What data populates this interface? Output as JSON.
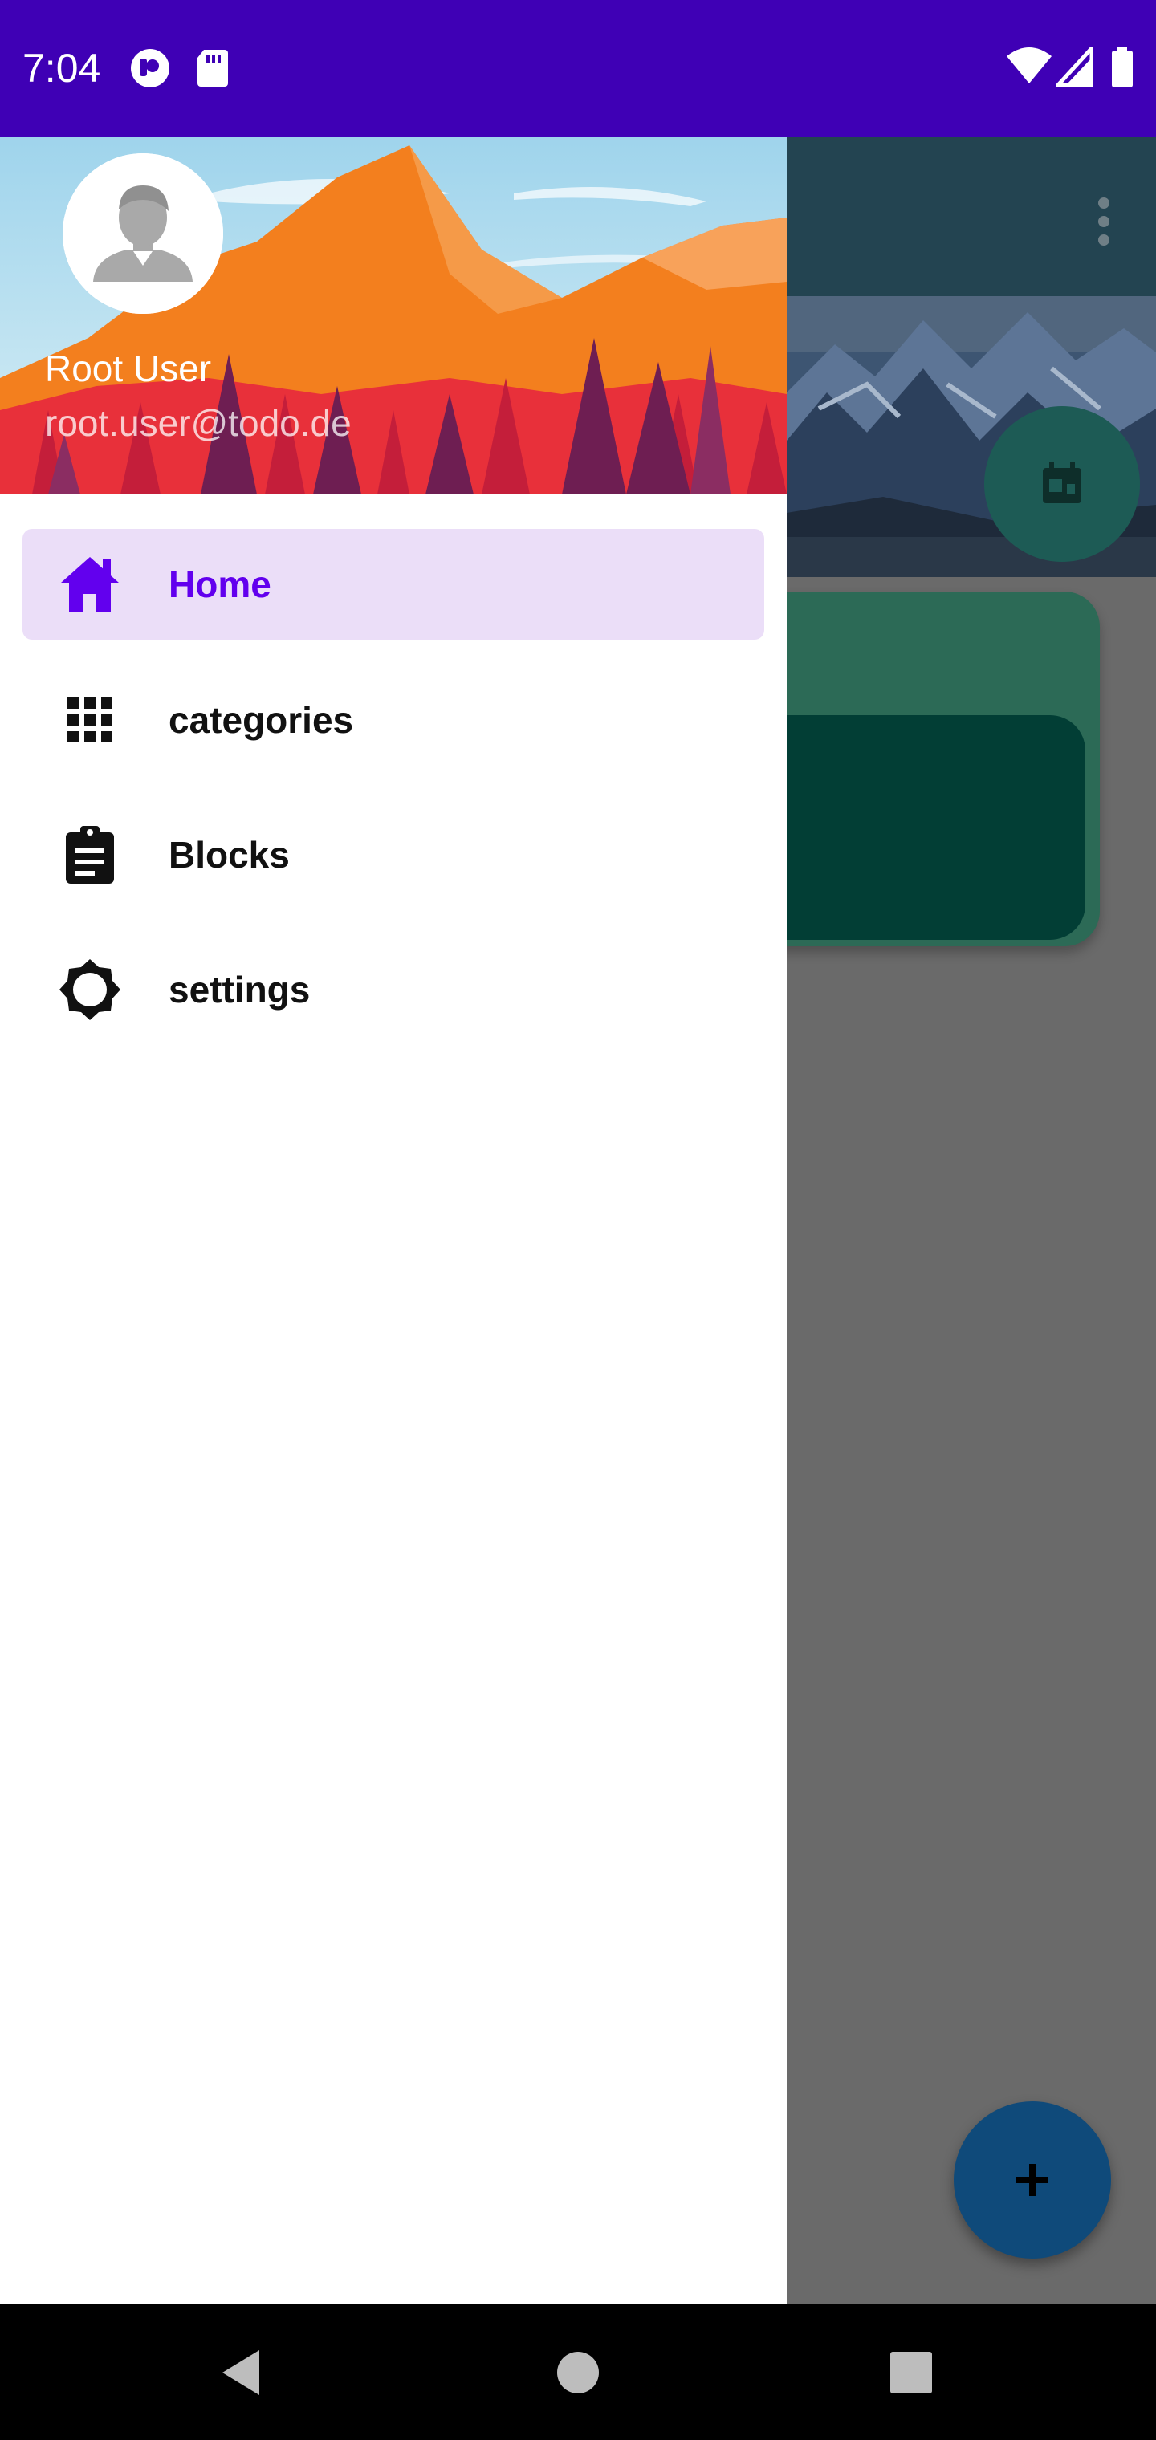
{
  "status_bar": {
    "time": "7:04",
    "background": "#3f00b5",
    "icons": [
      "notification-icon",
      "sd-card-icon",
      "wifi-icon",
      "signal-icon",
      "battery-icon"
    ]
  },
  "drawer": {
    "header": {
      "user_name": "Root User",
      "user_email": "root.user@todo.de",
      "avatar_icon": "person-icon"
    },
    "items": [
      {
        "label": "Home",
        "icon": "home-icon",
        "active": true
      },
      {
        "label": "categories",
        "icon": "grid-icon",
        "active": false
      },
      {
        "label": "Blocks",
        "icon": "clipboard-icon",
        "active": false
      },
      {
        "label": "settings",
        "icon": "brightness-icon",
        "active": false
      }
    ],
    "accent": "#6200ee",
    "active_bg": "#ebdef8"
  },
  "background_app": {
    "toolbar_icon": "more-vert-icon",
    "fab_top_icon": "calendar-icon",
    "fab_bottom_icon": "plus-icon"
  },
  "nav_bar": {
    "buttons": [
      "back-icon",
      "home-circle-icon",
      "recents-icon"
    ]
  }
}
